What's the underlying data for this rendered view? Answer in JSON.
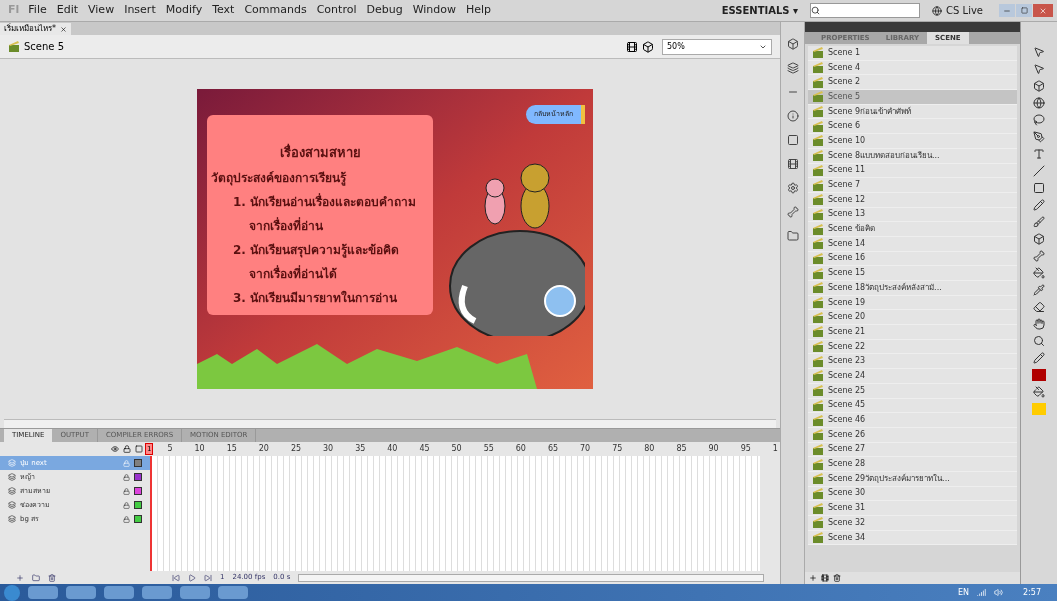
{
  "menu_bar": {
    "logo": "Fl",
    "items": [
      "File",
      "Edit",
      "View",
      "Insert",
      "Modify",
      "Text",
      "Commands",
      "Control",
      "Debug",
      "Window",
      "Help"
    ],
    "workspace": "ESSENTIALS ▾",
    "cs_live": "CS Live"
  },
  "document": {
    "tab": "เริ่มเหมือนไหร*",
    "scene": "Scene 5",
    "zoom": "50%"
  },
  "stage": {
    "title": "เรื่องสามสหาย",
    "heading": "วัตถุประสงค์ของการเรียนรู้",
    "lines": [
      {
        "text": "1. นักเรียนอ่านเรื่องและตอบคำถาม",
        "kind": "item"
      },
      {
        "text": "จากเรื่องที่อ่าน",
        "kind": "cont"
      },
      {
        "text": "2. นักเรียนสรุปความรู้และข้อคิด",
        "kind": "item"
      },
      {
        "text": "จากเรื่องที่อ่านได้",
        "kind": "cont"
      },
      {
        "text": "3. นักเรียนมีมารยาทในการอ่าน",
        "kind": "item"
      }
    ],
    "home_button": "กลับหน้าหลัก"
  },
  "timeline": {
    "tabs": [
      {
        "label": "TIMELINE",
        "selected": true
      },
      {
        "label": "OUTPUT",
        "selected": false
      },
      {
        "label": "COMPILER ERRORS",
        "selected": false
      },
      {
        "label": "MOTION EDITOR",
        "selected": false
      }
    ],
    "frame_numbers": [
      "5",
      "10",
      "15",
      "20",
      "25",
      "30",
      "35",
      "40",
      "45",
      "50",
      "55",
      "60",
      "65",
      "70",
      "75",
      "80",
      "85",
      "90",
      "95",
      "1"
    ],
    "playhead": "1",
    "layers": [
      {
        "name": "ปุ่ม next",
        "selected": true,
        "color": "#808080"
      },
      {
        "name": "หญ้า",
        "selected": false,
        "color": "#9933cc"
      },
      {
        "name": "สามสหาย",
        "selected": false,
        "color": "#dd44dd"
      },
      {
        "name": "ช่องความ",
        "selected": false,
        "color": "#44cc44"
      },
      {
        "name": "bg สร",
        "selected": false,
        "color": "#44cc44"
      }
    ],
    "frame": "1",
    "fps": "24.00 fps",
    "time": "0.0 s"
  },
  "panel": {
    "tabs": [
      {
        "label": "PROPERTIES",
        "selected": false
      },
      {
        "label": "LIBRARY",
        "selected": false
      },
      {
        "label": "SCENE",
        "selected": true
      }
    ],
    "scenes": [
      {
        "name": "Scene 1",
        "selected": false
      },
      {
        "name": "Scene 4",
        "selected": false
      },
      {
        "name": "Scene 2",
        "selected": false
      },
      {
        "name": "Scene 5",
        "selected": true
      },
      {
        "name": "Scene 9ก่อนเข้าคำศัพท์",
        "selected": false
      },
      {
        "name": "Scene 6",
        "selected": false
      },
      {
        "name": "Scene 10",
        "selected": false
      },
      {
        "name": "Scene 8แบบทดสอบก่อนเรียน...",
        "selected": false
      },
      {
        "name": "Scene 11",
        "selected": false
      },
      {
        "name": "Scene 7",
        "selected": false
      },
      {
        "name": "Scene 12",
        "selected": false
      },
      {
        "name": "Scene 13",
        "selected": false
      },
      {
        "name": "Scene ข้อคิด",
        "selected": false
      },
      {
        "name": "Scene 14",
        "selected": false
      },
      {
        "name": "Scene 16",
        "selected": false
      },
      {
        "name": "Scene 15",
        "selected": false
      },
      {
        "name": "Scene 18วัตถุประสงค์หลังสามั...",
        "selected": false
      },
      {
        "name": "Scene 19",
        "selected": false
      },
      {
        "name": "Scene 20",
        "selected": false
      },
      {
        "name": "Scene 21",
        "selected": false
      },
      {
        "name": "Scene 22",
        "selected": false
      },
      {
        "name": "Scene 23",
        "selected": false
      },
      {
        "name": "Scene 24",
        "selected": false
      },
      {
        "name": "Scene 25",
        "selected": false
      },
      {
        "name": "Scene 45",
        "selected": false
      },
      {
        "name": "Scene 46",
        "selected": false
      },
      {
        "name": "Scene 26",
        "selected": false
      },
      {
        "name": "Scene 27",
        "selected": false
      },
      {
        "name": "Scene 28",
        "selected": false
      },
      {
        "name": "Scene 29วัตถุประสงค์มารยาทใน...",
        "selected": false
      },
      {
        "name": "Scene 30",
        "selected": false
      },
      {
        "name": "Scene 31",
        "selected": false
      },
      {
        "name": "Scene 32",
        "selected": false
      },
      {
        "name": "Scene 34",
        "selected": false
      }
    ]
  },
  "tools": {
    "swatches": [
      {
        "kind": "stroke",
        "color": "#b00000"
      },
      {
        "kind": "fill",
        "color": "#ffcc00"
      }
    ]
  },
  "taskbar": {
    "language": "EN",
    "clock": "2:57"
  }
}
